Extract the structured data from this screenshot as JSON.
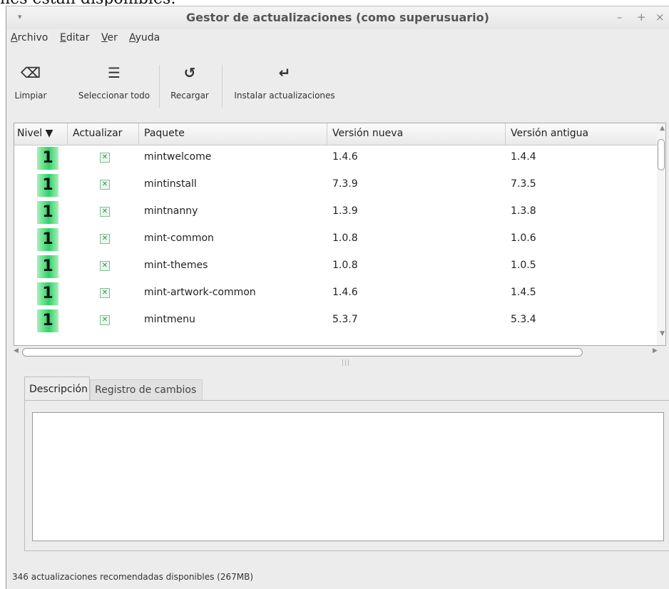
{
  "background_text": "nes están disponibles:",
  "window": {
    "title": "Gestor de actualizaciones (como superusuario)",
    "controls": {
      "menu": "▾",
      "minimize": "–",
      "maximize": "+",
      "close": "×"
    }
  },
  "menu": [
    {
      "prefix": "",
      "accel": "A",
      "rest": "rchivo"
    },
    {
      "prefix": "",
      "accel": "E",
      "rest": "ditar"
    },
    {
      "prefix": "",
      "accel": "V",
      "rest": "er"
    },
    {
      "prefix": "",
      "accel": "A",
      "rest": "yuda"
    }
  ],
  "toolbar": {
    "clear": {
      "label": "Limpiar",
      "icon": "clear-icon",
      "glyph": "⌫"
    },
    "select_all": {
      "label": "Seleccionar todo",
      "icon": "select-all-icon",
      "glyph": "☰"
    },
    "reload": {
      "label": "Recargar",
      "icon": "reload-icon",
      "glyph": "↺"
    },
    "install": {
      "label": "Instalar actualizaciones",
      "icon": "install-icon",
      "glyph": "↵"
    }
  },
  "table": {
    "columns": [
      "Nivel ▼",
      "Actualizar",
      "Paquete",
      "Versión nueva",
      "Versión antigua"
    ],
    "rows": [
      {
        "level": "1",
        "checked": true,
        "package": "mintwelcome",
        "new": "1.4.6",
        "old": "1.4.4"
      },
      {
        "level": "1",
        "checked": true,
        "package": "mintinstall",
        "new": "7.3.9",
        "old": "7.3.5"
      },
      {
        "level": "1",
        "checked": true,
        "package": "mintnanny",
        "new": "1.3.9",
        "old": "1.3.8"
      },
      {
        "level": "1",
        "checked": true,
        "package": "mint-common",
        "new": "1.0.8",
        "old": "1.0.6"
      },
      {
        "level": "1",
        "checked": true,
        "package": "mint-themes",
        "new": "1.0.8",
        "old": "1.0.5"
      },
      {
        "level": "1",
        "checked": true,
        "package": "mint-artwork-common",
        "new": "1.4.6",
        "old": "1.4.5"
      },
      {
        "level": "1",
        "checked": true,
        "package": "mintmenu",
        "new": "5.3.7",
        "old": "5.3.4"
      }
    ],
    "level_color": "#2fd06a"
  },
  "tabs": {
    "description": "Descripción",
    "changelog": "Registro de cambios"
  },
  "status": "346 actualizaciones recomendadas disponibles (267MB)"
}
